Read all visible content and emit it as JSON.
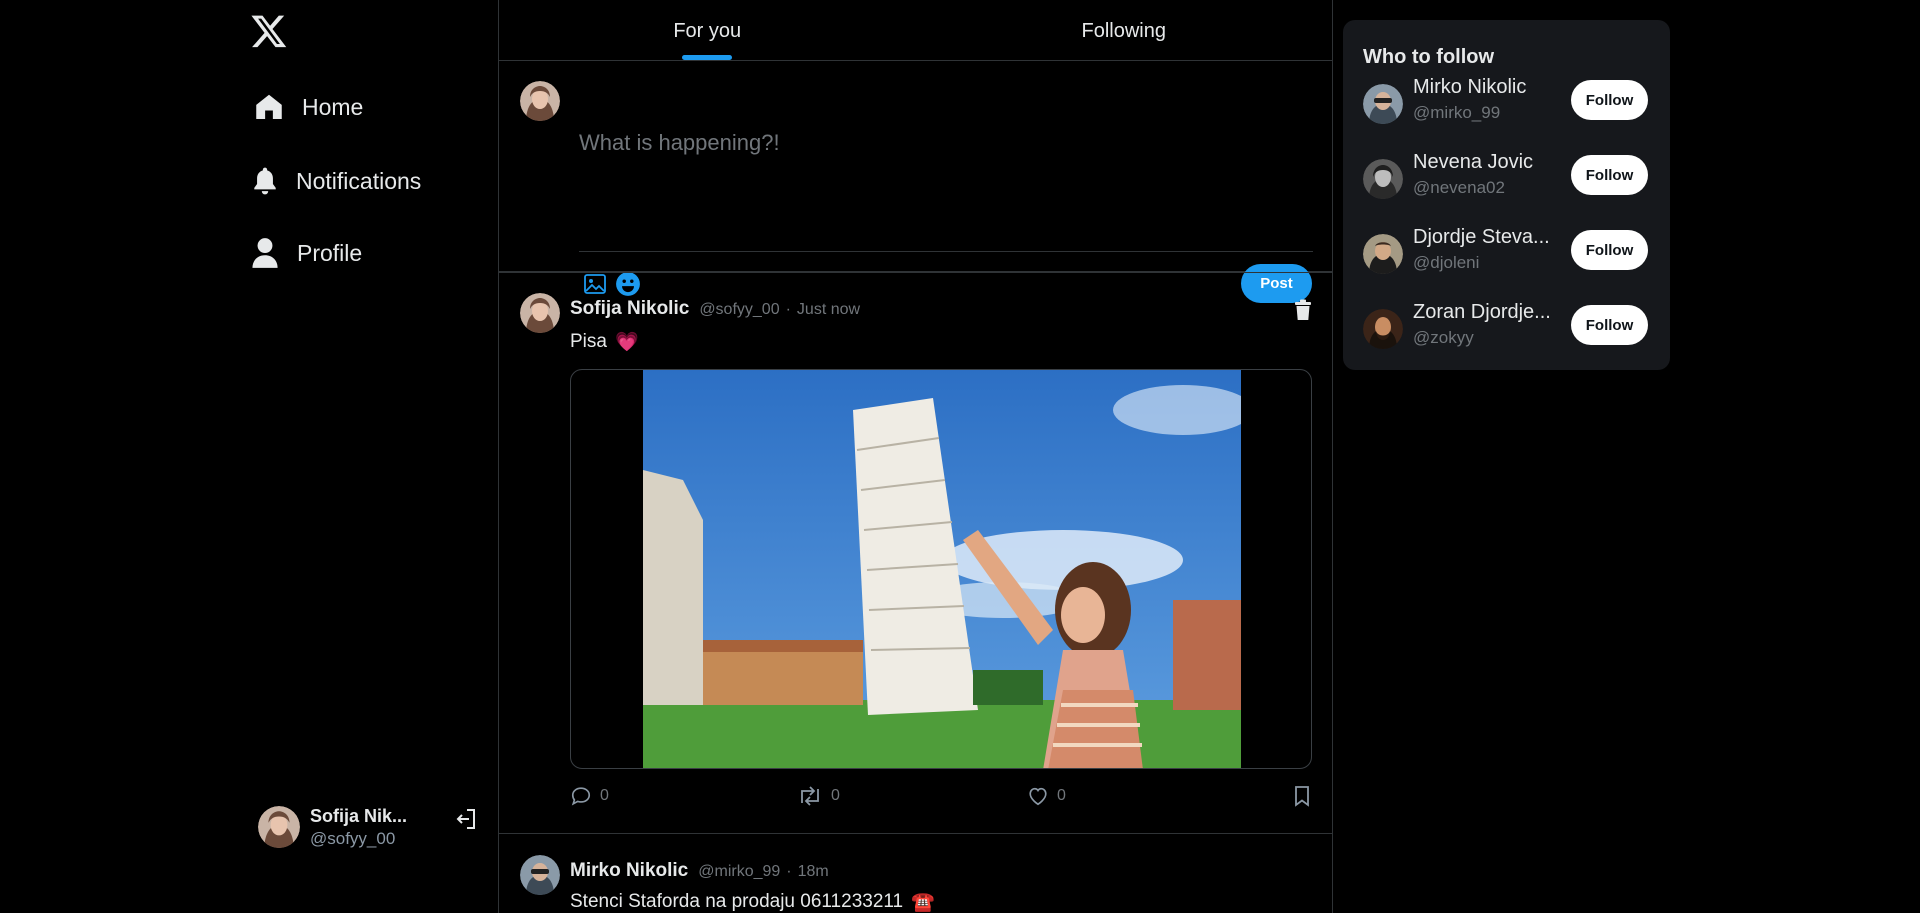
{
  "sidebar": {
    "logo": "x-logo-icon",
    "items": [
      {
        "label": "Home",
        "icon": "home-icon"
      },
      {
        "label": "Notifications",
        "icon": "bell-icon"
      },
      {
        "label": "Profile",
        "icon": "user-icon"
      }
    ],
    "account": {
      "name": "Sofija Nik...",
      "handle": "@sofyy_00",
      "logout_icon": "logout-icon"
    }
  },
  "feed": {
    "tabs": [
      {
        "label": "For you",
        "active": true
      },
      {
        "label": "Following",
        "active": false
      }
    ],
    "composer": {
      "placeholder": "What is happening?!",
      "post_label": "Post",
      "icons": [
        "image-icon",
        "emoji-icon"
      ]
    },
    "tweets": [
      {
        "name": "Sofija Nikolic",
        "handle": "@sofyy_00",
        "time": "Just now",
        "text": "Pisa",
        "emoji": "💗",
        "has_image": true,
        "reply_count": "0",
        "retweet_count": "0",
        "like_count": "0"
      },
      {
        "name": "Mirko Nikolic",
        "handle": "@mirko_99",
        "time": "18m",
        "text": "Stenci Staforda na prodaju 0611233211",
        "emoji": "☎️"
      }
    ]
  },
  "who_to_follow": {
    "title": "Who to follow",
    "follow_label": "Follow",
    "users": [
      {
        "name": "Mirko Nikolic",
        "handle": "@mirko_99"
      },
      {
        "name": "Nevena Jovic",
        "handle": "@nevena02"
      },
      {
        "name": "Djordje Steva...",
        "handle": "@djoleni"
      },
      {
        "name": "Zoran Djordje...",
        "handle": "@zokyy"
      }
    ]
  },
  "colors": {
    "background": "#000000",
    "accent": "#1d9bf0",
    "panel": "#16181c",
    "border": "#2f3336",
    "muted_text": "#71767b",
    "like_heart": "#f04899"
  }
}
